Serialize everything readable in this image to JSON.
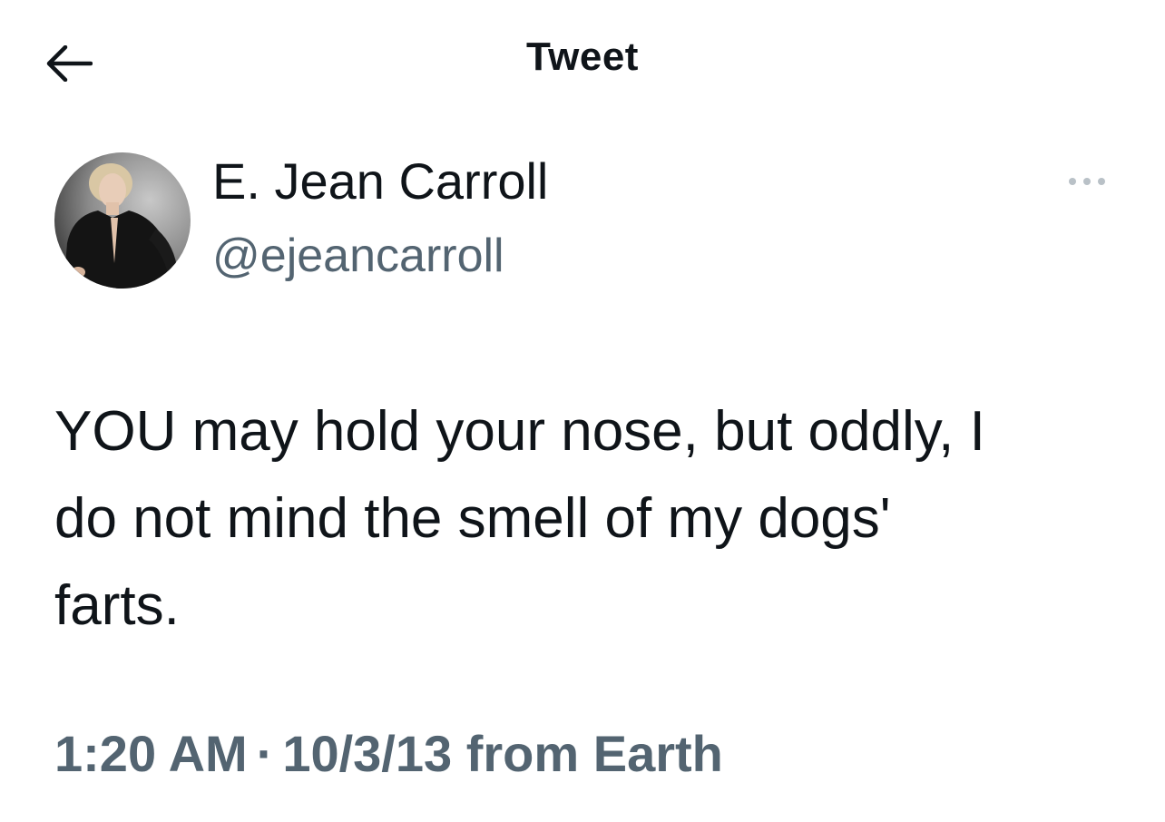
{
  "header": {
    "title": "Tweet",
    "back_icon": "arrow-left-icon"
  },
  "author": {
    "display_name": "E. Jean Carroll",
    "handle": "@ejeancarroll",
    "more_icon": "ellipsis-icon"
  },
  "tweet": {
    "text": "YOU may hold your nose, but oddly, I\ndo not mind the smell of my dogs'\nfarts."
  },
  "meta": {
    "time": "1:20 AM",
    "separator": "·",
    "date": "10/3/13",
    "source": "from Earth"
  },
  "colors": {
    "primary_text": "#0f1419",
    "secondary_text": "#536471",
    "background": "#ffffff"
  }
}
